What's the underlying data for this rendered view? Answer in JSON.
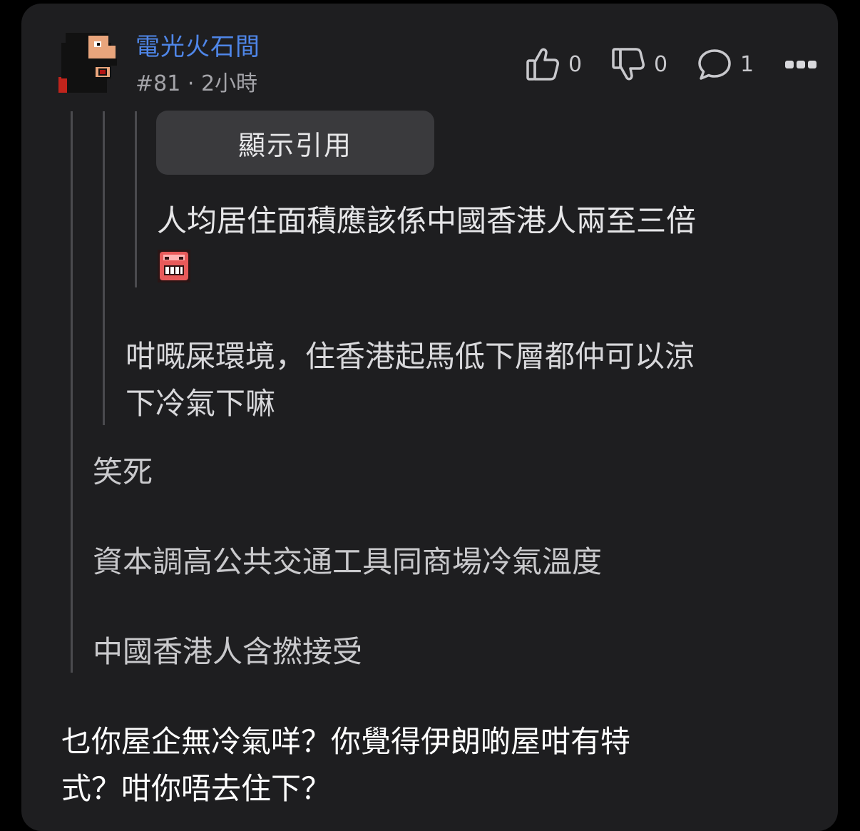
{
  "post": {
    "username": "電光火石間",
    "number": "#81",
    "separator": "·",
    "time": "2小時",
    "likes": "0",
    "dislikes": "0",
    "replies": "1",
    "show_quote_label": "顯示引用",
    "quote_level2": {
      "line1": "人均居住面積應該係中國香港人兩至三倍",
      "emoji": "grinning-face-emoji"
    },
    "quote_level1": {
      "line1": "咁嘅屎環境，住香港起馬低下層都仲可以涼",
      "line2": "下冷氣下嘛"
    },
    "quote_level0": {
      "line1": "笑死",
      "line2": "資本調高公共交通工具同商場冷氣溫度",
      "line3": "中國香港人含撚接受"
    },
    "reply": {
      "line1": "乜你屋企無冷氣咩？你覺得伊朗啲屋咁有特",
      "line2": "式？咁你唔去住下？"
    }
  },
  "colors": {
    "background": "#000000",
    "card": "#1e1e20",
    "username": "#4f86e8",
    "meta": "#a4a4a9",
    "quote_button": "#3a3a3d",
    "quote_bar": "#4a4a4e"
  }
}
